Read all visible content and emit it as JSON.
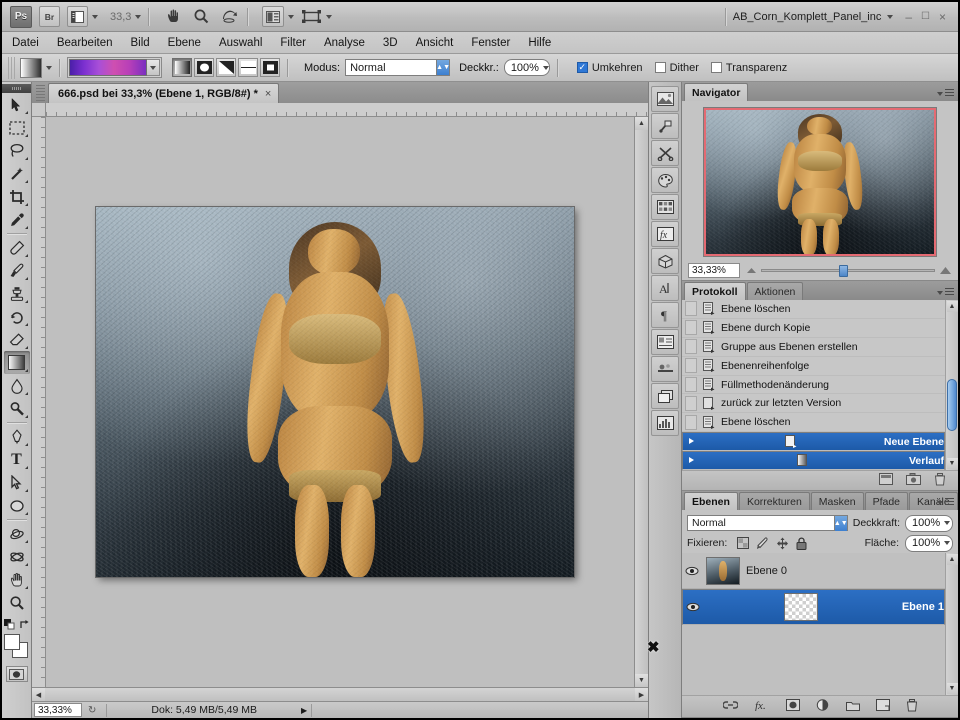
{
  "appbar": {
    "ps_logo": "Ps",
    "bridge_label": "Br",
    "zoom_level": "33,3",
    "document_name": "AB_Corn_Komplett_Panel_inc",
    "minimize": "–",
    "restore": "❐",
    "close": "×"
  },
  "menubar": {
    "items": [
      "Datei",
      "Bearbeiten",
      "Bild",
      "Ebene",
      "Auswahl",
      "Filter",
      "Analyse",
      "3D",
      "Ansicht",
      "Fenster",
      "Hilfe"
    ]
  },
  "options": {
    "gradient_types": [
      "linear-gradient-icon",
      "radial-gradient-icon",
      "angle-gradient-icon",
      "reflected-gradient-icon",
      "diamond-gradient-icon"
    ],
    "mode_label": "Modus:",
    "mode_value": "Normal",
    "opacity_label": "Deckkr.:",
    "opacity_value": "100%",
    "checkboxes": [
      {
        "label": "Umkehren",
        "checked": true
      },
      {
        "label": "Dither",
        "checked": false
      },
      {
        "label": "Transparenz",
        "checked": false
      }
    ],
    "gradient_colors": [
      "#4a1fa8",
      "#7b2fd0",
      "#a84fd8",
      "#cf4fb0",
      "#b83fb8",
      "#7a2fc0"
    ]
  },
  "document": {
    "tab_title": "666.psd bei 33,3% (Ebene 1, RGB/8#) *",
    "close_glyph": "×"
  },
  "statusbar": {
    "zoom": "33,33%",
    "doc_info": "Dok: 5,49 MB/5,49 MB",
    "arrow": "▶"
  },
  "navigator": {
    "tab": "Navigator",
    "zoom_value": "33,33%"
  },
  "history": {
    "tabs": [
      "Protokoll",
      "Aktionen"
    ],
    "active_tab": "Protokoll",
    "items": [
      {
        "label": "Ebene löschen",
        "selected": false
      },
      {
        "label": "Ebene durch Kopie",
        "selected": false
      },
      {
        "label": "Gruppe aus Ebenen erstellen",
        "selected": false
      },
      {
        "label": "Ebenenreihenfolge",
        "selected": false
      },
      {
        "label": "Füllmethodenänderung",
        "selected": false
      },
      {
        "label": "zurück zur letzten Version",
        "selected": false
      },
      {
        "label": "Ebene löschen",
        "selected": false
      },
      {
        "label": "Neue Ebene",
        "selected": true
      },
      {
        "label": "Verlauf",
        "selected": true
      }
    ],
    "footer_buttons": [
      "create-document-from-state-icon",
      "create-snapshot-icon",
      "delete-state-icon"
    ]
  },
  "layers": {
    "tabs": [
      "Ebenen",
      "Korrekturen",
      "Masken",
      "Pfade",
      "Kanäle"
    ],
    "active_tab": "Ebenen",
    "blend_mode": "Normal",
    "opacity_label": "Deckkraft:",
    "opacity_value": "100%",
    "lock_label": "Fixieren:",
    "fill_label": "Fläche:",
    "fill_value": "100%",
    "lock_icons": [
      "lock-transparent-pixels-icon",
      "lock-image-pixels-icon",
      "lock-position-icon",
      "lock-all-icon"
    ],
    "rows": [
      {
        "name": "Ebene 0",
        "visible": true,
        "selected": false,
        "thumb": "photo"
      },
      {
        "name": "Ebene 1",
        "visible": true,
        "selected": true,
        "thumb": "transparent"
      }
    ],
    "footer_buttons": [
      "link-layers-icon",
      "layer-style-icon",
      "layer-mask-icon",
      "adjustment-layer-icon",
      "new-group-icon",
      "new-layer-icon",
      "delete-layer-icon"
    ]
  },
  "toolbox": {
    "tools": [
      {
        "name": "move-tool",
        "active": false
      },
      {
        "name": "rectangular-marquee-tool",
        "active": false
      },
      {
        "name": "lasso-tool",
        "active": false
      },
      {
        "name": "magic-wand-tool",
        "active": false
      },
      {
        "name": "crop-tool",
        "active": false
      },
      {
        "name": "eyedropper-tool",
        "active": false
      },
      {
        "name": "spot-healing-brush-tool",
        "active": false
      },
      {
        "name": "brush-tool",
        "active": false
      },
      {
        "name": "clone-stamp-tool",
        "active": false
      },
      {
        "name": "history-brush-tool",
        "active": false
      },
      {
        "name": "eraser-tool",
        "active": false
      },
      {
        "name": "gradient-tool",
        "active": true
      },
      {
        "name": "blur-tool",
        "active": false
      },
      {
        "name": "dodge-tool",
        "active": false
      },
      {
        "name": "pen-tool",
        "active": false
      },
      {
        "name": "type-tool",
        "active": false
      },
      {
        "name": "path-selection-tool",
        "active": false
      },
      {
        "name": "ellipse-shape-tool",
        "active": false
      },
      {
        "name": "3d-rotate-tool",
        "active": false
      },
      {
        "name": "3d-orbit-tool",
        "active": false
      },
      {
        "name": "hand-tool",
        "active": false
      },
      {
        "name": "zoom-tool",
        "active": false
      }
    ],
    "type_glyph": "T"
  },
  "icondock": {
    "buttons": [
      "mini-bridge-icon",
      "tool-presets-icon",
      "scissors-icon",
      "color-panel-icon",
      "swatches-icon",
      "styles-icon",
      "3d-panel-icon",
      "character-icon",
      "paragraph-icon",
      "info-panel-icon",
      "animation-icon",
      "layer-comps-icon",
      "histogram-icon"
    ]
  },
  "colors": {
    "selection_blue": "#1d5aa8",
    "navigator_view_box": "#e46a72",
    "panel_background": "#c4c4c4",
    "chrome": "#b8b8b8"
  }
}
